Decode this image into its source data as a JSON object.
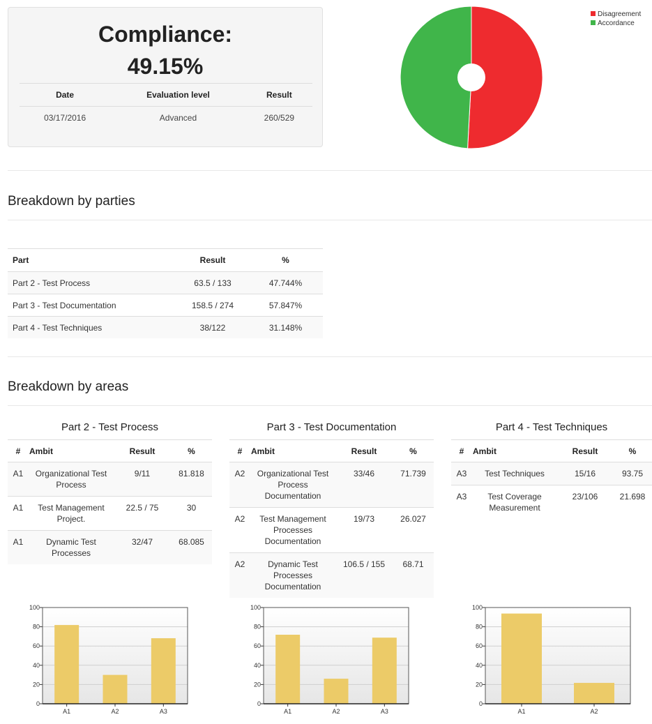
{
  "summary": {
    "label": "Compliance:",
    "value": "49.15%",
    "headers": [
      "Date",
      "Evaluation level",
      "Result"
    ],
    "row": [
      "03/17/2016",
      "Advanced",
      "260/529"
    ]
  },
  "legend": [
    {
      "label": "Disagreement",
      "color": "#ee2b2f"
    },
    {
      "label": "Accordance",
      "color": "#40b54a"
    }
  ],
  "parties": {
    "title": "Breakdown by parties",
    "headers": [
      "Part",
      "Result",
      "%"
    ],
    "rows": [
      [
        "Part 2 - Test Process",
        "63.5 / 133",
        "47.744%"
      ],
      [
        "Part 3 - Test Documentation",
        "158.5 / 274",
        "57.847%"
      ],
      [
        "Part 4 - Test Techniques",
        "38/122",
        "31.148%"
      ]
    ]
  },
  "areas": {
    "title": "Breakdown by areas",
    "headers": [
      "#",
      "Ambit",
      "Result",
      "%"
    ],
    "parts": [
      {
        "title": "Part 2 - Test Process",
        "rows": [
          [
            "A1",
            "Organizational Test Process",
            "9/11",
            "81.818"
          ],
          [
            "A1",
            "Test Management Project.",
            "22.5 / 75",
            "30"
          ],
          [
            "A1",
            "Dynamic Test Processes",
            "32/47",
            "68.085"
          ]
        ]
      },
      {
        "title": "Part 3 - Test Documentation",
        "rows": [
          [
            "A2",
            "Organizational Test Process Documentation",
            "33/46",
            "71.739"
          ],
          [
            "A2",
            "Test Management Processes Documentation",
            "19/73",
            "26.027"
          ],
          [
            "A2",
            "Dynamic Test Processes Documentation",
            "106.5 / 155",
            "68.71"
          ]
        ]
      },
      {
        "title": "Part 4 - Test Techniques",
        "rows": [
          [
            "A3",
            "Test Techniques",
            "15/16",
            "93.75"
          ],
          [
            "A3",
            "Test Coverage Measurement",
            "23/106",
            "21.698"
          ]
        ]
      }
    ]
  },
  "chart_data": [
    {
      "type": "pie",
      "categories": [
        "Disagreement",
        "Accordance"
      ],
      "values": [
        50.85,
        49.15
      ],
      "colors": [
        "#ee2b2f",
        "#40b54a"
      ],
      "donut_hole": true,
      "legend_position": "top-right"
    },
    {
      "type": "bar",
      "categories": [
        "A1",
        "A2",
        "A3"
      ],
      "values": [
        81.818,
        30,
        68.085
      ],
      "ylim": [
        0,
        100
      ],
      "yticks": [
        0,
        20,
        40,
        60,
        80,
        100
      ],
      "grid": true,
      "color": "#eccb68"
    },
    {
      "type": "bar",
      "categories": [
        "A1",
        "A2",
        "A3"
      ],
      "values": [
        71.739,
        26.027,
        68.71
      ],
      "ylim": [
        0,
        100
      ],
      "yticks": [
        0,
        20,
        40,
        60,
        80,
        100
      ],
      "grid": true,
      "color": "#eccb68"
    },
    {
      "type": "bar",
      "categories": [
        "A1",
        "A2"
      ],
      "values": [
        93.75,
        21.698
      ],
      "ylim": [
        0,
        100
      ],
      "yticks": [
        0,
        20,
        40,
        60,
        80,
        100
      ],
      "grid": true,
      "color": "#eccb68"
    }
  ]
}
